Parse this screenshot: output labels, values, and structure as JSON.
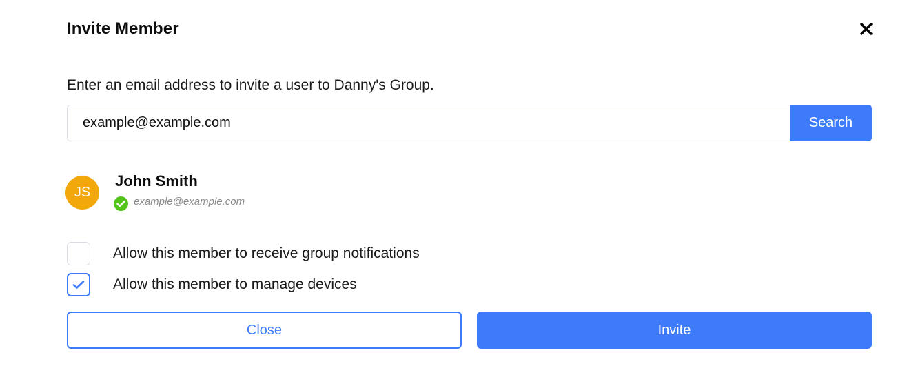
{
  "dialog": {
    "title": "Invite Member",
    "close_icon": "close-icon",
    "description": "Enter an email address to invite a user to Danny's Group."
  },
  "search": {
    "value": "example@example.com",
    "button_label": "Search"
  },
  "result": {
    "initials": "JS",
    "name": "John Smith",
    "email": "example@example.com",
    "verified_icon": "check-circle-icon",
    "avatar_color": "#f2a70b",
    "verified_color": "#52c41a"
  },
  "options": {
    "notifications": {
      "label": "Allow this member to receive group notifications",
      "checked": false
    },
    "manage_devices": {
      "label": "Allow this member to manage devices",
      "checked": true
    }
  },
  "actions": {
    "close_label": "Close",
    "invite_label": "Invite"
  },
  "colors": {
    "accent": "#3d7bfa"
  }
}
